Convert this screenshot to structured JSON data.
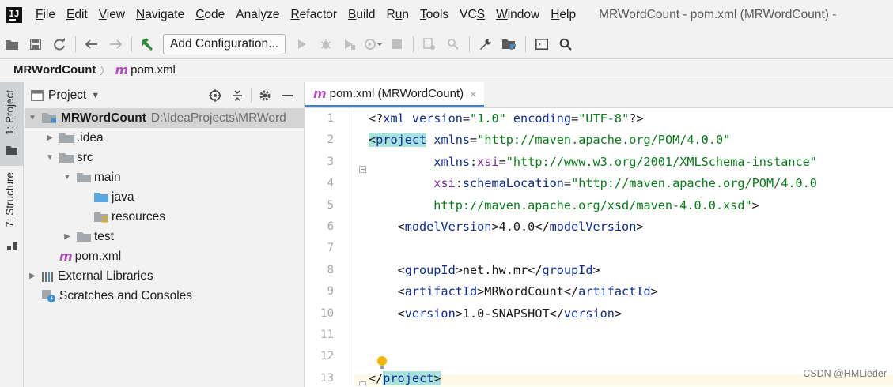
{
  "app": {
    "logo_text": "IJ",
    "window_title": "MRWordCount - pom.xml (MRWordCount) -"
  },
  "menu": {
    "items": [
      {
        "mnemonic": "F",
        "rest": "ile"
      },
      {
        "mnemonic": "E",
        "rest": "dit"
      },
      {
        "mnemonic": "V",
        "rest": "iew"
      },
      {
        "mnemonic": "N",
        "rest": "avigate"
      },
      {
        "mnemonic": "C",
        "rest": "ode"
      },
      {
        "mnemonic": "",
        "rest": "Analyze"
      },
      {
        "mnemonic": "R",
        "rest": "efactor"
      },
      {
        "mnemonic": "B",
        "rest": "uild"
      },
      {
        "pre": "R",
        "mnemonic": "u",
        "rest": "n"
      },
      {
        "mnemonic": "T",
        "rest": "ools"
      },
      {
        "pre": "VC",
        "mnemonic": "S",
        "rest": ""
      },
      {
        "mnemonic": "W",
        "rest": "indow"
      },
      {
        "mnemonic": "H",
        "rest": "elp"
      }
    ]
  },
  "toolbar": {
    "add_config_label": "Add Configuration...",
    "icons": [
      "open-folder-icon",
      "save-icon",
      "sync-icon",
      "back-arrow-icon",
      "forward-arrow-icon",
      "build-hammer-icon",
      "run-icon",
      "debug-icon",
      "coverage-icon",
      "profile-icon",
      "stop-icon",
      "attach-icon",
      "search-everywhere-icon",
      "settings-wrench-icon",
      "project-structure-icon",
      "terminal-icon",
      "search-icon"
    ],
    "accent_color": "#2e8b37"
  },
  "breadcrumb": {
    "project": "MRWordCount",
    "file_icon": "m",
    "file": "pom.xml"
  },
  "left_strip": {
    "project_label": "1: Project",
    "structure_label": "7: Structure"
  },
  "project_panel": {
    "title": "Project",
    "tree": [
      {
        "indent": 0,
        "arrow": "▼",
        "icon": "module-folder",
        "label": "MRWordCount",
        "bold": true,
        "hint": "D:\\IdeaProjects\\MRWord",
        "selected": true
      },
      {
        "indent": 1,
        "arrow": "▶",
        "icon": "gray-folder",
        "label": ".idea"
      },
      {
        "indent": 1,
        "arrow": "▼",
        "icon": "gray-folder",
        "label": "src"
      },
      {
        "indent": 2,
        "arrow": "▼",
        "icon": "gray-folder",
        "label": "main"
      },
      {
        "indent": 3,
        "arrow": "",
        "icon": "blue-folder",
        "label": "java"
      },
      {
        "indent": 3,
        "arrow": "",
        "icon": "resources-folder",
        "label": "resources"
      },
      {
        "indent": 2,
        "arrow": "▶",
        "icon": "gray-folder",
        "label": "test"
      },
      {
        "indent": 1,
        "arrow": "",
        "icon": "maven-file",
        "label": "pom.xml"
      },
      {
        "indent": 0,
        "arrow": "▶",
        "icon": "libraries",
        "label": "External Libraries"
      },
      {
        "indent": 0,
        "arrow": "",
        "icon": "scratches",
        "label": "Scratches and Consoles"
      }
    ]
  },
  "editor": {
    "tab_icon": "m",
    "tab_label": "pom.xml (MRWordCount)",
    "tab_close": "×",
    "line_numbers": [
      "1",
      "2",
      "3",
      "4",
      "5",
      "6",
      "7",
      "8",
      "9",
      "10",
      "11",
      "12",
      "13"
    ],
    "lines": [
      [
        {
          "c": "pt",
          "t": "<?"
        },
        {
          "c": "t",
          "t": "xml"
        },
        {
          "c": "an",
          "t": " version"
        },
        {
          "c": "pt",
          "t": "="
        },
        {
          "c": "av",
          "t": "\"1.0\""
        },
        {
          "c": "an",
          "t": " encoding"
        },
        {
          "c": "pt",
          "t": "="
        },
        {
          "c": "av",
          "t": "\"UTF-8\""
        },
        {
          "c": "pt",
          "t": "?>"
        }
      ],
      [
        {
          "c": "pt hl",
          "t": "<"
        },
        {
          "c": "t hl",
          "t": "project"
        },
        {
          "c": "an",
          "t": " xmlns"
        },
        {
          "c": "pt",
          "t": "="
        },
        {
          "c": "av",
          "t": "\"http://maven.apache.org/POM/4.0.0\""
        }
      ],
      [
        {
          "c": "pt",
          "t": "         "
        },
        {
          "c": "an",
          "t": "xmlns"
        },
        {
          "c": "pt",
          "t": ":"
        },
        {
          "c": "ans",
          "t": "xsi"
        },
        {
          "c": "pt",
          "t": "="
        },
        {
          "c": "av",
          "t": "\"http://www.w3.org/2001/XMLSchema-instance\""
        }
      ],
      [
        {
          "c": "pt",
          "t": "         "
        },
        {
          "c": "ans",
          "t": "xsi"
        },
        {
          "c": "pt",
          "t": ":"
        },
        {
          "c": "an",
          "t": "schemaLocation"
        },
        {
          "c": "pt",
          "t": "="
        },
        {
          "c": "av",
          "t": "\"http://maven.apache.org/POM/4.0.0"
        }
      ],
      [
        {
          "c": "av",
          "t": "         http://maven.apache.org/xsd/maven-4.0.0.xsd\""
        },
        {
          "c": "pt",
          "t": ">"
        }
      ],
      [
        {
          "c": "pt",
          "t": "    <"
        },
        {
          "c": "t",
          "t": "modelVersion"
        },
        {
          "c": "pt",
          "t": ">4.0.0</"
        },
        {
          "c": "t",
          "t": "modelVersion"
        },
        {
          "c": "pt",
          "t": ">"
        }
      ],
      [],
      [
        {
          "c": "pt",
          "t": "    <"
        },
        {
          "c": "t",
          "t": "groupId"
        },
        {
          "c": "pt",
          "t": ">net.hw.mr</"
        },
        {
          "c": "t",
          "t": "groupId"
        },
        {
          "c": "pt",
          "t": ">"
        }
      ],
      [
        {
          "c": "pt",
          "t": "    <"
        },
        {
          "c": "t",
          "t": "artifactId"
        },
        {
          "c": "pt",
          "t": ">MRWordCount</"
        },
        {
          "c": "t",
          "t": "artifactId"
        },
        {
          "c": "pt",
          "t": ">"
        }
      ],
      [
        {
          "c": "pt",
          "t": "    <"
        },
        {
          "c": "t",
          "t": "version"
        },
        {
          "c": "pt",
          "t": ">1.0-SNAPSHOT</"
        },
        {
          "c": "t",
          "t": "version"
        },
        {
          "c": "pt",
          "t": ">"
        }
      ],
      [],
      [],
      [
        {
          "c": "pt",
          "t": "</"
        },
        {
          "c": "t hl",
          "t": "project"
        },
        {
          "c": "pt hl",
          "t": ">"
        }
      ]
    ]
  },
  "watermark": "CSDN @HMLieder"
}
